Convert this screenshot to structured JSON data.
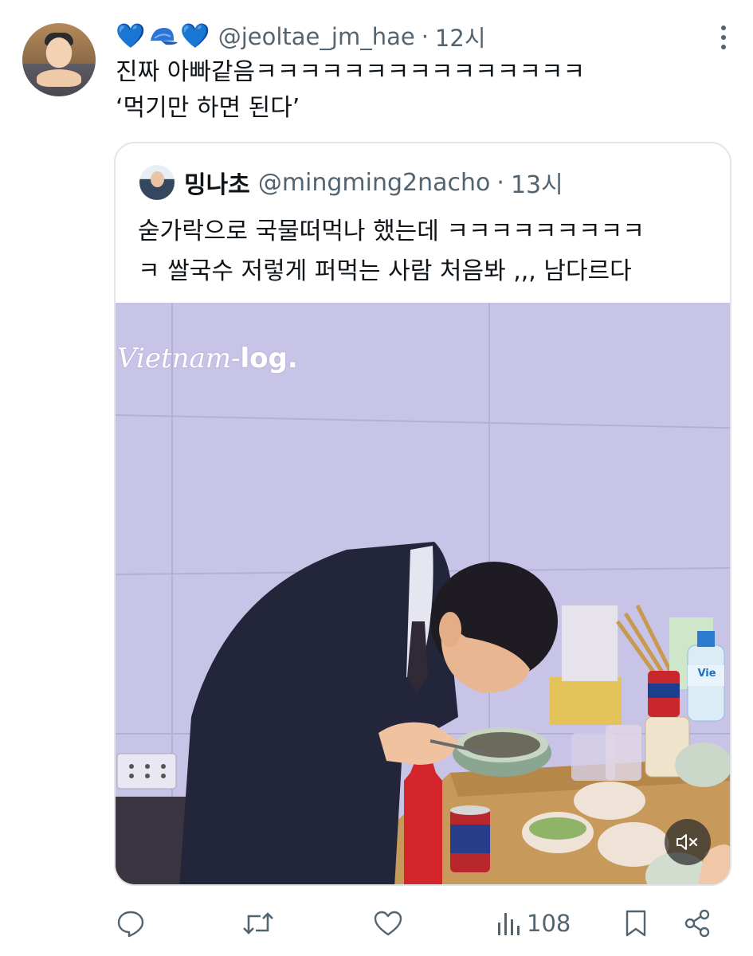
{
  "tweet": {
    "emojis": [
      "💙",
      "🧢",
      "💙"
    ],
    "handle": "@jeoltae_jm_hae",
    "separator": "·",
    "time": "12시",
    "text_line1": "진짜 아빠같음ㅋㅋㅋㅋㅋㅋㅋㅋㅋㅋㅋㅋㅋㅋㅋ",
    "text_line2": "‘먹기만 하면 된다’"
  },
  "quote": {
    "name": "밍나초",
    "handle": "@mingming2nacho",
    "separator": "·",
    "time": "13시",
    "text_line1": "숟가락으로 국물떠먹나 했는데 ㅋㅋㅋㅋㅋㅋㅋㅋㅋ",
    "text_line2": "ㅋ 쌀국수 저렇게 퍼먹는 사람 처음봐 ,,, 남다르다",
    "video": {
      "watermark_italic": "Vietnam-",
      "watermark_bold": "log.",
      "bottle_brand": "Vie"
    }
  },
  "actions": {
    "views_count": "108"
  },
  "colors": {
    "text_primary": "#0f1419",
    "text_secondary": "#536471",
    "heart_blue": "#3ba3f5",
    "video_wall": "#c8c4e8"
  }
}
